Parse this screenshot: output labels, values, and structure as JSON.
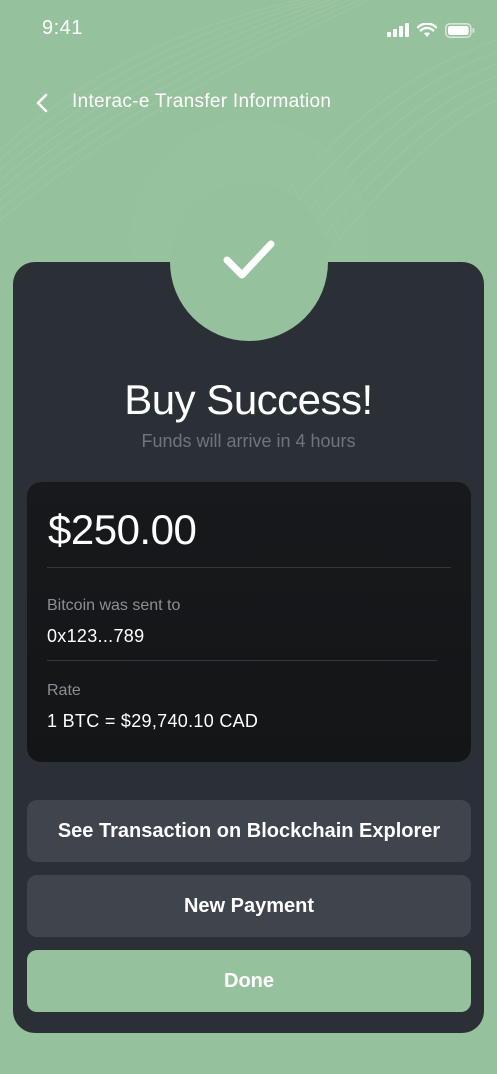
{
  "status_bar": {
    "time": "9:41",
    "icons": [
      "cellular-signal-icon",
      "wifi-icon",
      "battery-icon"
    ]
  },
  "header": {
    "back_icon": "chevron-left-icon",
    "title": "Interac-e Transfer Information"
  },
  "result": {
    "icon": "checkmark-icon",
    "title": "Buy Success!",
    "subtitle": "Funds will arrive in 4 hours"
  },
  "details": {
    "amount": "$250.00",
    "recipient_label": "Bitcoin was sent to",
    "recipient_value": "0x123...789",
    "rate_label": "Rate",
    "rate_value": "1 BTC = $29,740.10 CAD"
  },
  "actions": {
    "explorer_label": "See Transaction on Blockchain Explorer",
    "new_payment_label": "New Payment",
    "done_label": "Done"
  },
  "colors": {
    "background": "#95c19c",
    "card": "#2b3036",
    "details_panel": "#141618",
    "secondary_button": "#3f444d",
    "primary_button": "#95c19c"
  }
}
